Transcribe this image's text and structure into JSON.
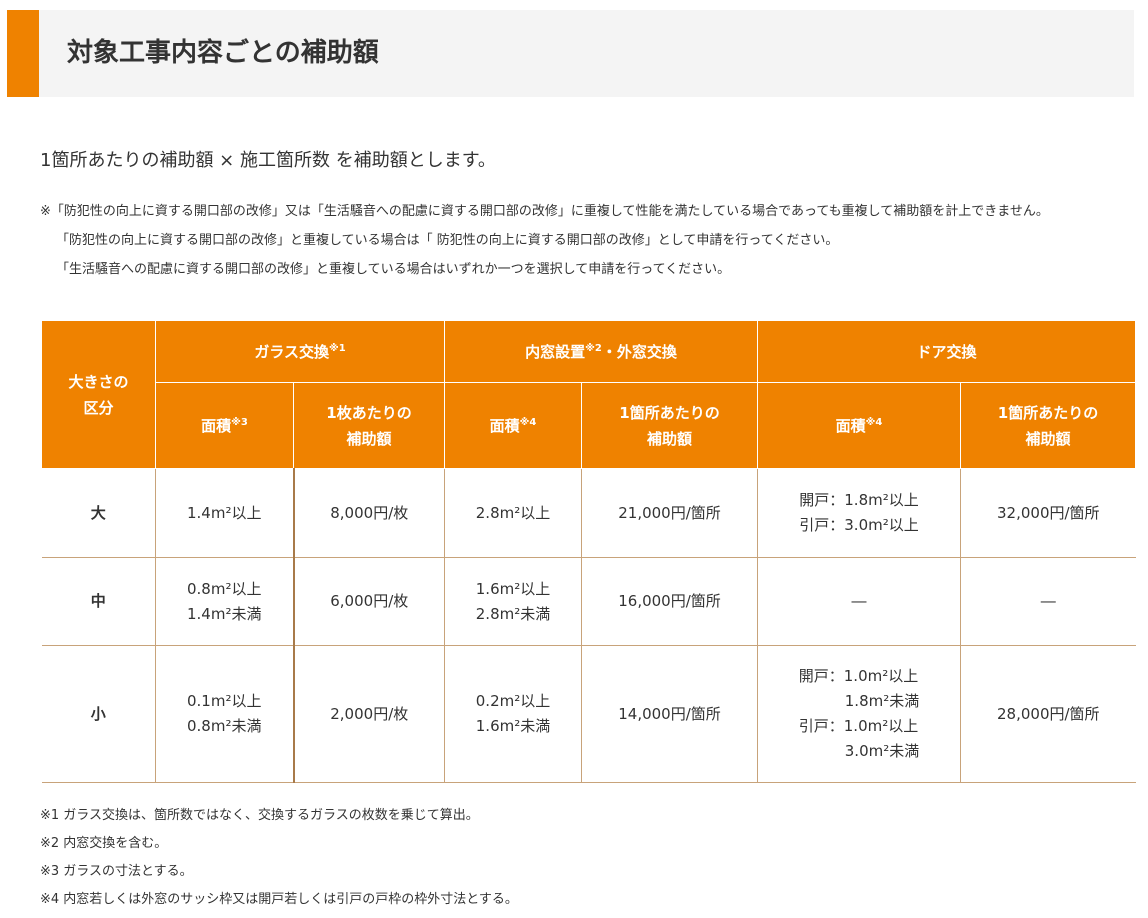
{
  "heading": {
    "title": "対象工事内容ごとの補助額"
  },
  "intro": "1箇所あたりの補助額 × 施工箇所数 を補助額とします。",
  "notes_top": [
    "※「防犯性の向上に資する開口部の改修」又は「生活騒音への配慮に資する開口部の改修」に重複して性能を満たしている場合であっても重複して補助額を計上できません。",
    "「防犯性の向上に資する開口部の改修」と重複している場合は「 防犯性の向上に資する開口部の改修」として申請を行ってください。",
    "「生活騒音への配慮に資する開口部の改修」と重複している場合はいずれか一つを選択して申請を行ってください。"
  ],
  "table": {
    "size_header": [
      "大きさの",
      "区分"
    ],
    "groups": [
      {
        "label": "ガラス交換",
        "sup": "※1"
      },
      {
        "label_pre": "内窓設置",
        "sup": "※2",
        "label_post": "・外窓交換"
      },
      {
        "label": "ドア交換"
      }
    ],
    "sub": {
      "area": "面積",
      "area_sup_glass": "※3",
      "area_sup_other": "※4",
      "per_sheet": [
        "1枚あたりの",
        "補助額"
      ],
      "per_place": [
        "1箇所あたりの",
        "補助額"
      ]
    },
    "rows": [
      {
        "size": "大",
        "glass_area": [
          "1.4m²以上"
        ],
        "glass_amount": "8,000円/枚",
        "window_area": [
          "2.8m²以上"
        ],
        "window_amount": "21,000円/箇所",
        "door_area": [
          "開戸：1.8m²以上",
          "引戸：3.0m²以上"
        ],
        "door_amount": "32,000円/箇所"
      },
      {
        "size": "中",
        "glass_area": [
          "0.8m²以上",
          "1.4m²未満"
        ],
        "glass_amount": "6,000円/枚",
        "window_area": [
          "1.6m²以上",
          "2.8m²未満"
        ],
        "window_amount": "16,000円/箇所",
        "door_area_dash": "―",
        "door_amount_dash": "―"
      },
      {
        "size": "小",
        "glass_area": [
          "0.1m²以上",
          "0.8m²未満"
        ],
        "glass_amount": "2,000円/枚",
        "window_area": [
          "0.2m²以上",
          "1.6m²未満"
        ],
        "window_amount": "14,000円/箇所",
        "door_area": [
          "開戸：1.0m²以上",
          "1.8m²未満",
          "引戸：1.0m²以上",
          "3.0m²未満"
        ],
        "door_amount": "28,000円/箇所"
      }
    ]
  },
  "footnotes": [
    "※1  ガラス交換は、箇所数ではなく、交換するガラスの枚数を乗じて算出。",
    "※2  内窓交換を含む。",
    "※3  ガラスの寸法とする。",
    "※4  内窓若しくは外窓のサッシ枠又は開戸若しくは引戸の戸枠の枠外寸法とする。"
  ],
  "colors": {
    "accent": "#ef8200",
    "heading_bg": "#f4f4f4",
    "border": "#c8a37a"
  }
}
